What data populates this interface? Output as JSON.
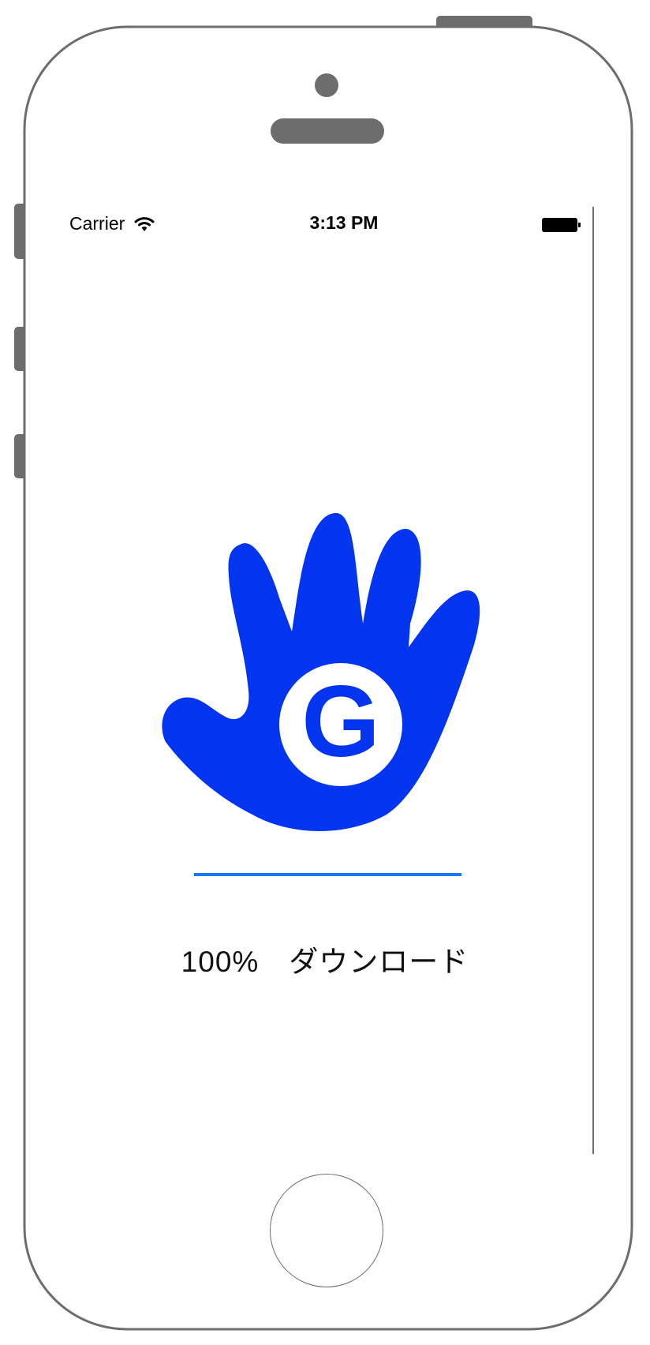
{
  "status_bar": {
    "carrier": "Carrier",
    "time": "3:13 PM",
    "wifi_icon": "wifi-icon",
    "battery_icon": "battery-icon"
  },
  "logo": {
    "icon": "hand-g-logo-icon",
    "letter": "G",
    "color": "#0335f0"
  },
  "download": {
    "progress_fraction": 1.0,
    "status_text": "100%　ダウンロード",
    "progress_color": "#1877f2"
  },
  "device": {
    "frame_color": "#6d6d6d",
    "home_button_icon": "home-button"
  }
}
